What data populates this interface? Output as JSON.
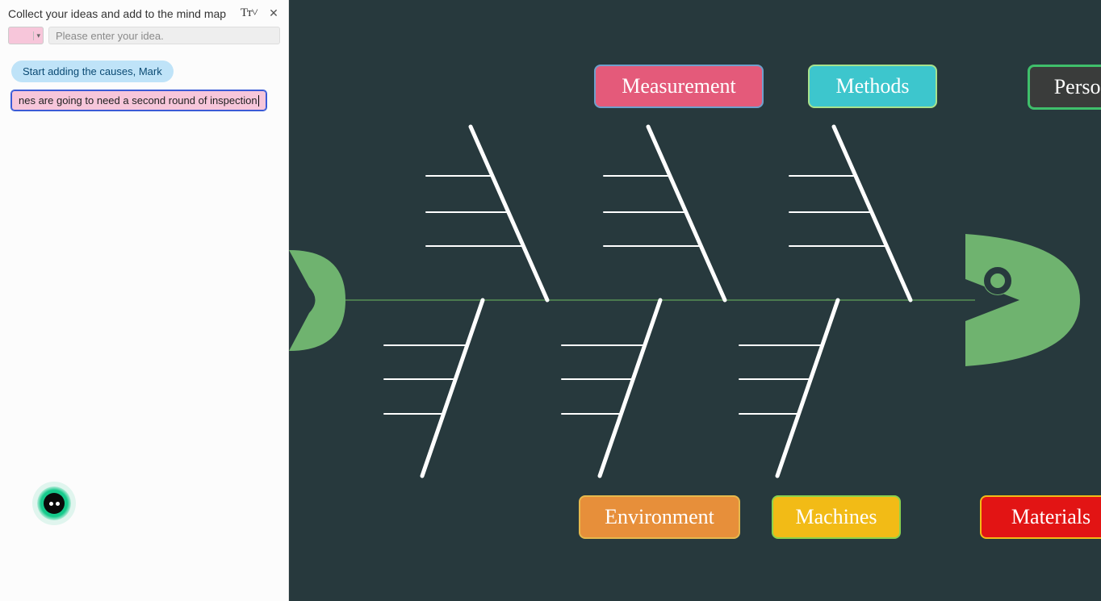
{
  "sidebar": {
    "title": "Collect your ideas and add to the mind map",
    "font_button_label": "Tᴛ˅",
    "close_label": "✕",
    "input_placeholder": "Please enter your idea.",
    "color_swatch_caret": "▾",
    "chips": {
      "instruction": "Start adding the causes, Mark",
      "editing_visible_text": "nes are going to need a second round of inspection"
    },
    "ai_fab_name": "ai-assistant"
  },
  "diagram": {
    "type": "fishbone",
    "categories_top": [
      {
        "key": "measurement",
        "label": "Measurement",
        "bg": "#e45a7a",
        "border": "#6fa0cc"
      },
      {
        "key": "methods",
        "label": "Methods",
        "bg": "#3dc6cd",
        "border": "#a7e28c"
      },
      {
        "key": "personnel",
        "label": "Personnel",
        "bg": "#3a3c3b",
        "border": "#3fbf6b"
      }
    ],
    "categories_bottom": [
      {
        "key": "environment",
        "label": "Environment",
        "bg": "#e78f3a",
        "border": "#e6b94d"
      },
      {
        "key": "machines",
        "label": "Machines",
        "bg": "#f2bb16",
        "border": "#8bd24c"
      },
      {
        "key": "materials",
        "label": "Materials",
        "bg": "#e21414",
        "border": "#f2bb16"
      }
    ],
    "spine_color": "#4a7a4e",
    "bone_color": "#ffffff",
    "fish_head_color": "#6fb36f",
    "fish_tail_color": "#6fb36f",
    "background": "#27393d"
  },
  "chart_data": {
    "type": "diagram",
    "subtype": "fishbone-ishikawa",
    "effect": "",
    "causes": {
      "Measurement": [],
      "Methods": [],
      "Personnel": [],
      "Environment": [],
      "Machines": [],
      "Materials": []
    },
    "sub_bone_slots_per_category": 3
  }
}
